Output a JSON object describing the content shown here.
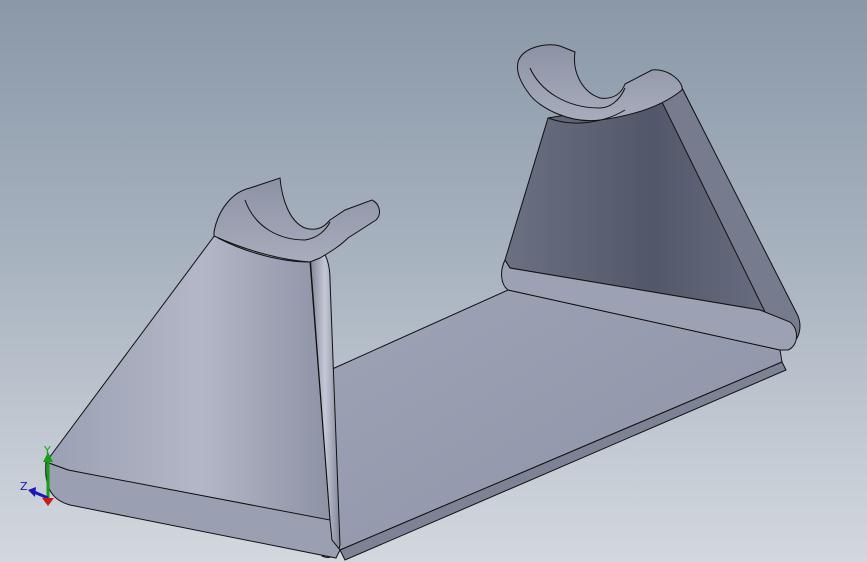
{
  "viewport": {
    "background_top": "#8a98a8",
    "background_bottom": "#d3d8de"
  },
  "part": {
    "name": "bracket",
    "face_color": "#8f95a8",
    "edge_color": "#111111"
  },
  "triad": {
    "x_label": "",
    "y_label": "Y",
    "z_label": "Z",
    "x_color": "#cc1a1a",
    "y_color": "#1a9e1a",
    "z_color": "#1a1ab4"
  }
}
